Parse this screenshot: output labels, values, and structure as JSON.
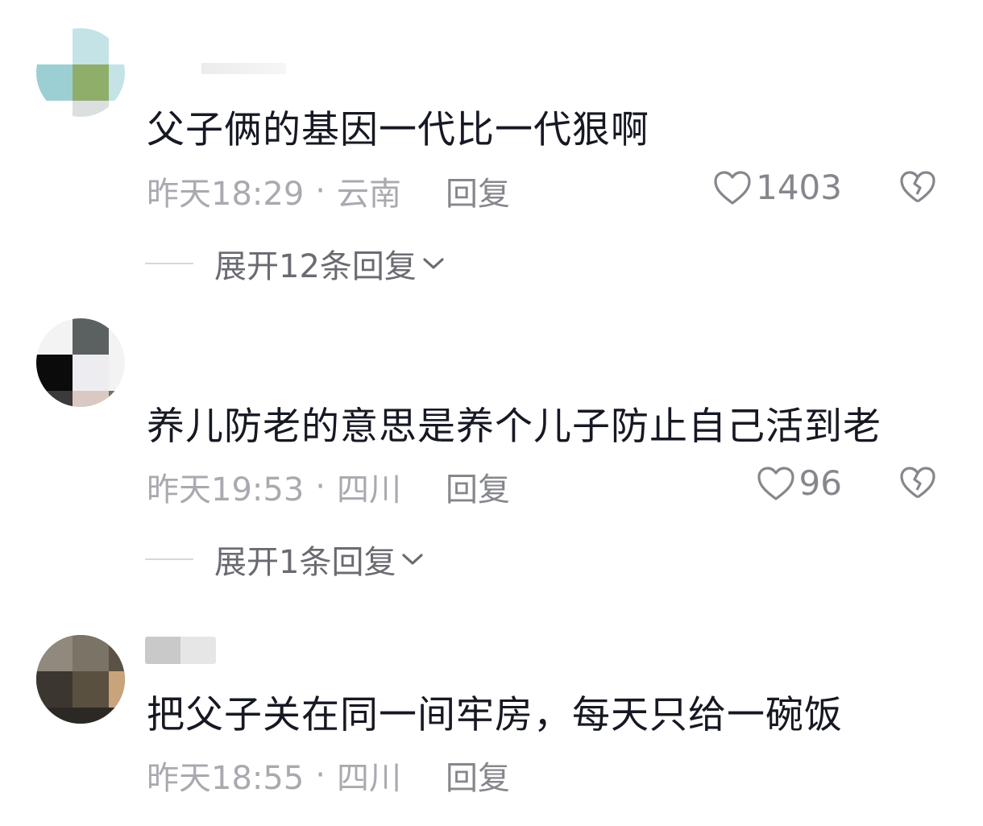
{
  "comments": [
    {
      "content": "父子俩的基因一代比一代狠啊",
      "time": "昨天18:29",
      "separator": "·",
      "location": "云南",
      "reply_label": "回复",
      "likes": "1403",
      "expand_label": "展开12条回复"
    },
    {
      "content": "养儿防老的意思是养个儿子防止自己活到老",
      "time": "昨天19:53",
      "separator": "·",
      "location": "四川",
      "reply_label": "回复",
      "likes": "96",
      "expand_label": "展开1条回复"
    },
    {
      "content": "把父子关在同一间牢房，每天只给一碗饭",
      "time": "昨天18:55",
      "separator": "·",
      "location": "四川",
      "reply_label": "回复"
    }
  ],
  "icons": {
    "like": "heart-outline-icon",
    "dislike": "broken-heart-icon",
    "expand": "chevron-down-icon"
  },
  "colors": {
    "text_primary": "#161823",
    "text_meta": "#a9aab0",
    "text_secondary": "#86878d",
    "divider": "#d6d7db"
  }
}
